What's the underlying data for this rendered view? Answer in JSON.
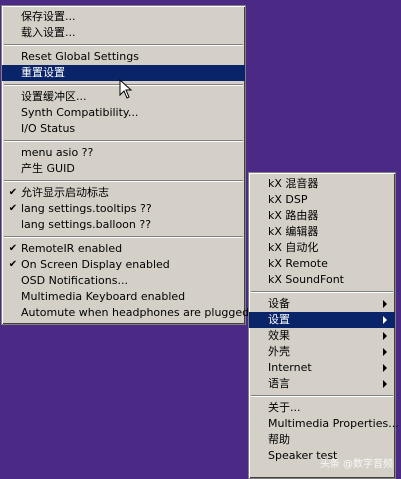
{
  "colors": {
    "desktop": "#4b2a86",
    "menu_bg": "#d4d0c8",
    "menu_highlight": "#0a246a",
    "menu_text": "#000000",
    "menu_text_selected": "#ffffff"
  },
  "left_menu": {
    "items": [
      {
        "label": "保存设置..."
      },
      {
        "label": "载入设置..."
      },
      {
        "label": "Reset Global Settings"
      },
      {
        "label": "重置设置"
      },
      {
        "label": "设置缓冲区..."
      },
      {
        "label": "Synth Compatibility..."
      },
      {
        "label": "I/O Status"
      },
      {
        "label": "menu asio ??"
      },
      {
        "label": "产生 GUID"
      },
      {
        "label": "允许显示启动标志",
        "checked": true
      },
      {
        "label": "lang settings.tooltips ??",
        "checked": true
      },
      {
        "label": "lang settings.balloon ??"
      },
      {
        "label": "RemoteIR enabled",
        "checked": true
      },
      {
        "label": "On Screen Display enabled",
        "checked": true
      },
      {
        "label": "OSD Notifications..."
      },
      {
        "label": "Multimedia Keyboard enabled"
      },
      {
        "label": "Automute when headphones are plugged-in"
      }
    ]
  },
  "right_menu": {
    "items": [
      {
        "label": "kX 混音器"
      },
      {
        "label": "kX DSP"
      },
      {
        "label": "kX 路由器"
      },
      {
        "label": "kX 编辑器"
      },
      {
        "label": "kX 自动化"
      },
      {
        "label": "kX Remote"
      },
      {
        "label": "kX SoundFont"
      },
      {
        "label": "设备"
      },
      {
        "label": "设置"
      },
      {
        "label": "效果"
      },
      {
        "label": "外壳"
      },
      {
        "label": "Internet"
      },
      {
        "label": "语言"
      },
      {
        "label": "关于..."
      },
      {
        "label": "Multimedia Properties..."
      },
      {
        "label": "帮助"
      },
      {
        "label": "Speaker test"
      }
    ]
  },
  "checkmark_glyph": "✔",
  "watermark": {
    "text": "头条 @数字音频"
  }
}
